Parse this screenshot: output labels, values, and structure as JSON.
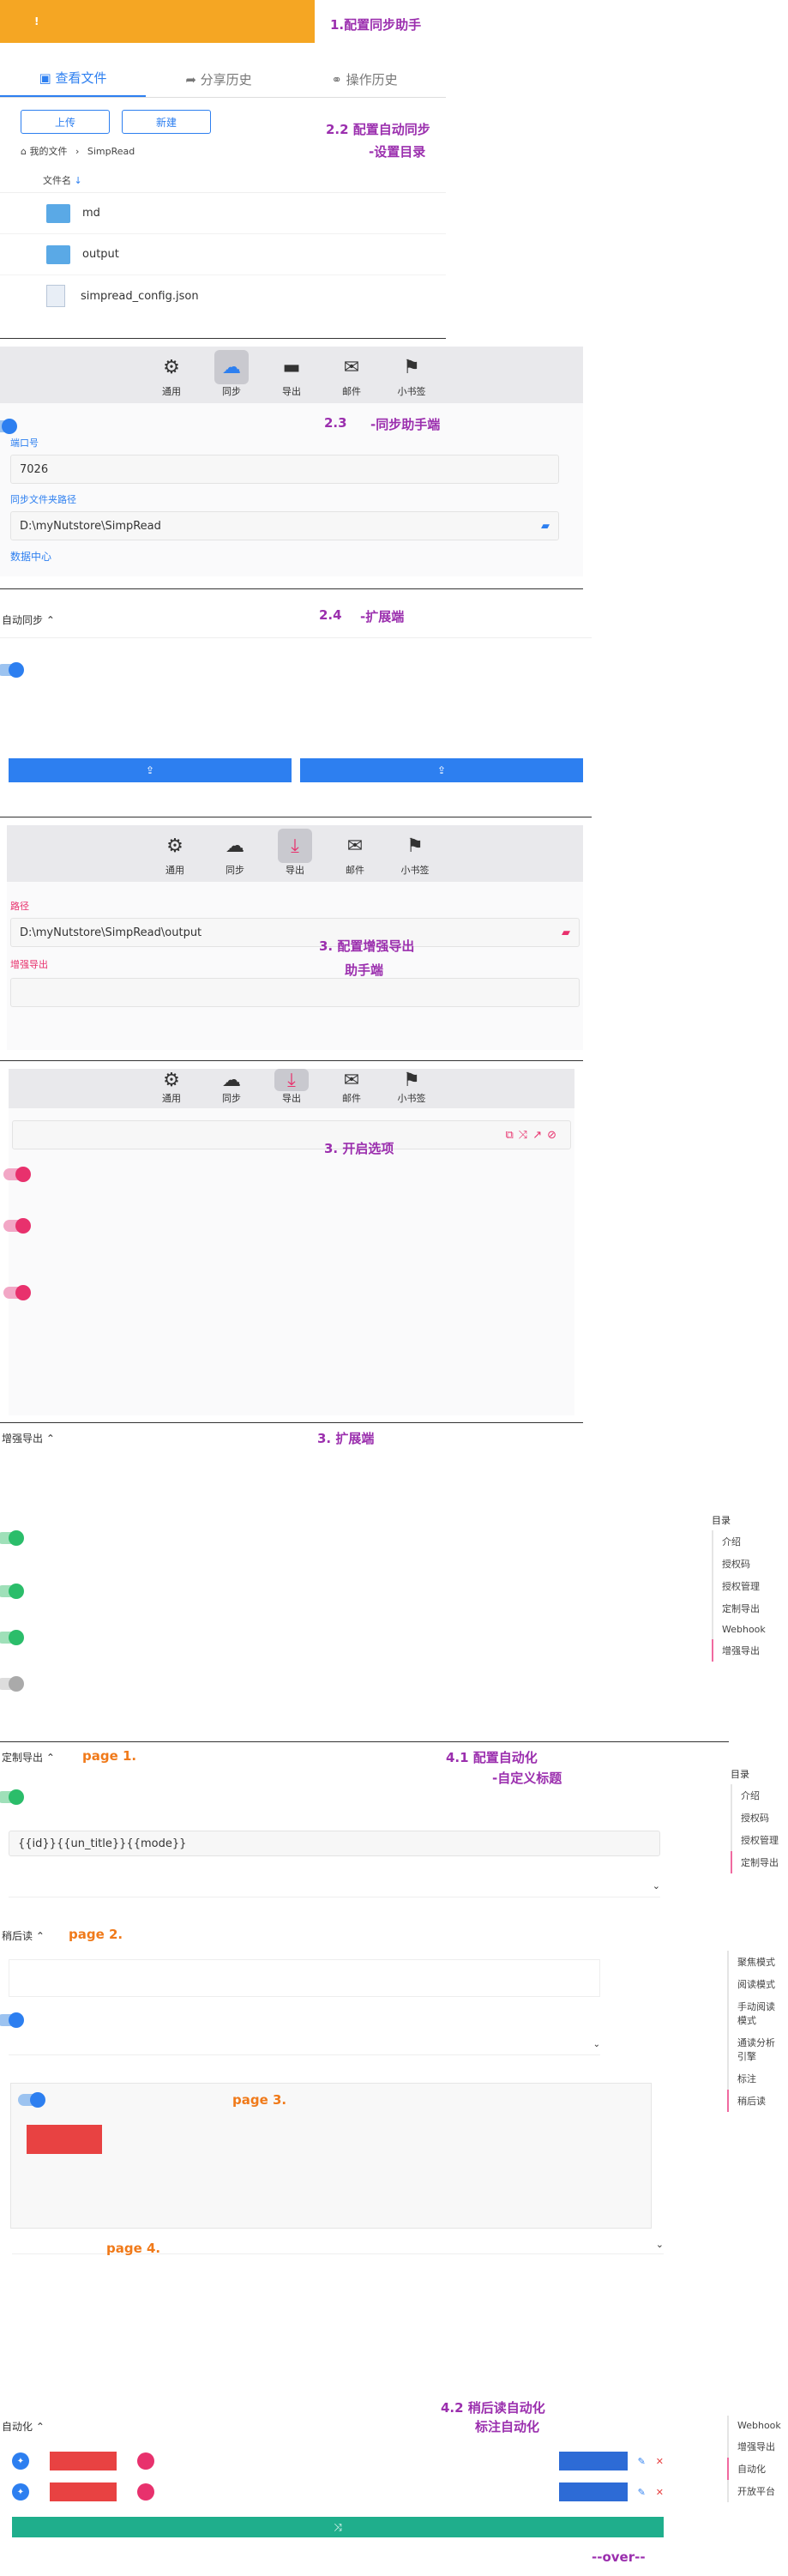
{
  "banner": {
    "text": "",
    "icon": "warning-icon",
    "color": "#f5a623"
  },
  "notes": {
    "n1": "1.配置同步助手",
    "n22": "2.2 配置自动同步",
    "n22b": "-设置目录",
    "n23": "2.3",
    "n23b": "-同步助手端",
    "n24": "2.4",
    "n24b": "-扩展端",
    "n3a": "3. 配置增强导出",
    "n3a2": "助手端",
    "n3b": "3. 开启选项",
    "n3c": "3. 扩展端",
    "n41": "4.1 配置自动化",
    "n41b": "-自定义标题",
    "p1": "page 1.",
    "p2": "page 2.",
    "p3": "page 3.",
    "p4": "page 4.",
    "n42": "4.2 稍后读自动化",
    "n42b": "标注自动化",
    "over": "--over--"
  },
  "filebrowser": {
    "tabs": [
      "查看文件",
      "分享历史",
      "操作历史"
    ],
    "upload": "上传",
    "new": "新建",
    "breadcrumb_root": "我的文件",
    "breadcrumb_sep": "›",
    "breadcrumb_child": "SimpRead",
    "col_name": "文件名",
    "files": [
      {
        "name": "md",
        "type": "folder"
      },
      {
        "name": "output",
        "type": "folder"
      },
      {
        "name": "simpread_config.json",
        "type": "file"
      }
    ]
  },
  "tabbar": [
    "通用",
    "同步",
    "导出",
    "邮件",
    "小书签"
  ],
  "sync": {
    "desc": "",
    "port_label": "端口号",
    "port": "7026",
    "folder_label": "同步文件夹路径",
    "folder": "D:\\myNutstore\\SimpRead",
    "data_center": "数据中心"
  },
  "ext_sync": {
    "title": "自动同步",
    "question": "",
    "desc": "",
    "btn1": "",
    "btn2": ""
  },
  "export_assist": {
    "intro": "",
    "path_label": "路径",
    "path": "D:\\myNutstore\\SimpRead\\output",
    "enhance_label": "增强导出",
    "enhance_desc": "",
    "placeholder": ""
  },
  "options": {
    "token_placeholder": "",
    "sub1": "",
    "items": [
      {
        "q": "",
        "d": ""
      },
      {
        "q": "",
        "d": "",
        "d2": ""
      },
      {
        "q": "",
        "d": "",
        "d2": ""
      }
    ],
    "sub2": ""
  },
  "ext_export": {
    "title": "增强导出",
    "intro": "",
    "items": [
      {
        "q": "",
        "d": ""
      },
      {
        "q": "",
        "d": ""
      },
      {
        "q": "",
        "d": ""
      },
      {
        "q": "",
        "d": ""
      }
    ],
    "sidebar_title": "目录",
    "sidebar": [
      "介绍",
      "授权码",
      "授权管理",
      "定制导出",
      "Webhook",
      "增强导出"
    ]
  },
  "custom_export": {
    "title": "定制导出",
    "q": "",
    "d": "",
    "tpl": "{{id}}{{un_title}}{{mode}}",
    "hint": "",
    "html_q": "",
    "html_select": "",
    "sidebar_title": "目录",
    "sidebar": [
      "介绍",
      "授权码",
      "授权管理",
      "定制导出"
    ]
  },
  "readlater": {
    "title": "稍后读",
    "field_label": "",
    "field": "",
    "q1": "",
    "q2": "",
    "q2_select": "",
    "sidebar": [
      "聚焦模式",
      "阅读模式",
      "手动阅读模式",
      "通读分析引擎",
      "标注",
      "稍后读"
    ]
  },
  "offline": {
    "q": "",
    "lines": [
      "",
      "",
      "",
      ""
    ],
    "save": "",
    "exit": ""
  },
  "export_opts": {
    "title": "",
    "select": "",
    "lines": [
      "",
      "",
      "",
      "",
      "",
      "",
      ""
    ]
  },
  "automation": {
    "title": "自动化",
    "rows": [
      {
        "action": "",
        "tag": "",
        "mid": "",
        "label": "",
        "select": ""
      },
      {
        "action": "",
        "tag": "",
        "mid": "",
        "label": "",
        "select": ""
      }
    ],
    "add_btn": "",
    "sidebar": [
      "Webhook",
      "增强导出",
      "自动化",
      "开放平台"
    ]
  }
}
